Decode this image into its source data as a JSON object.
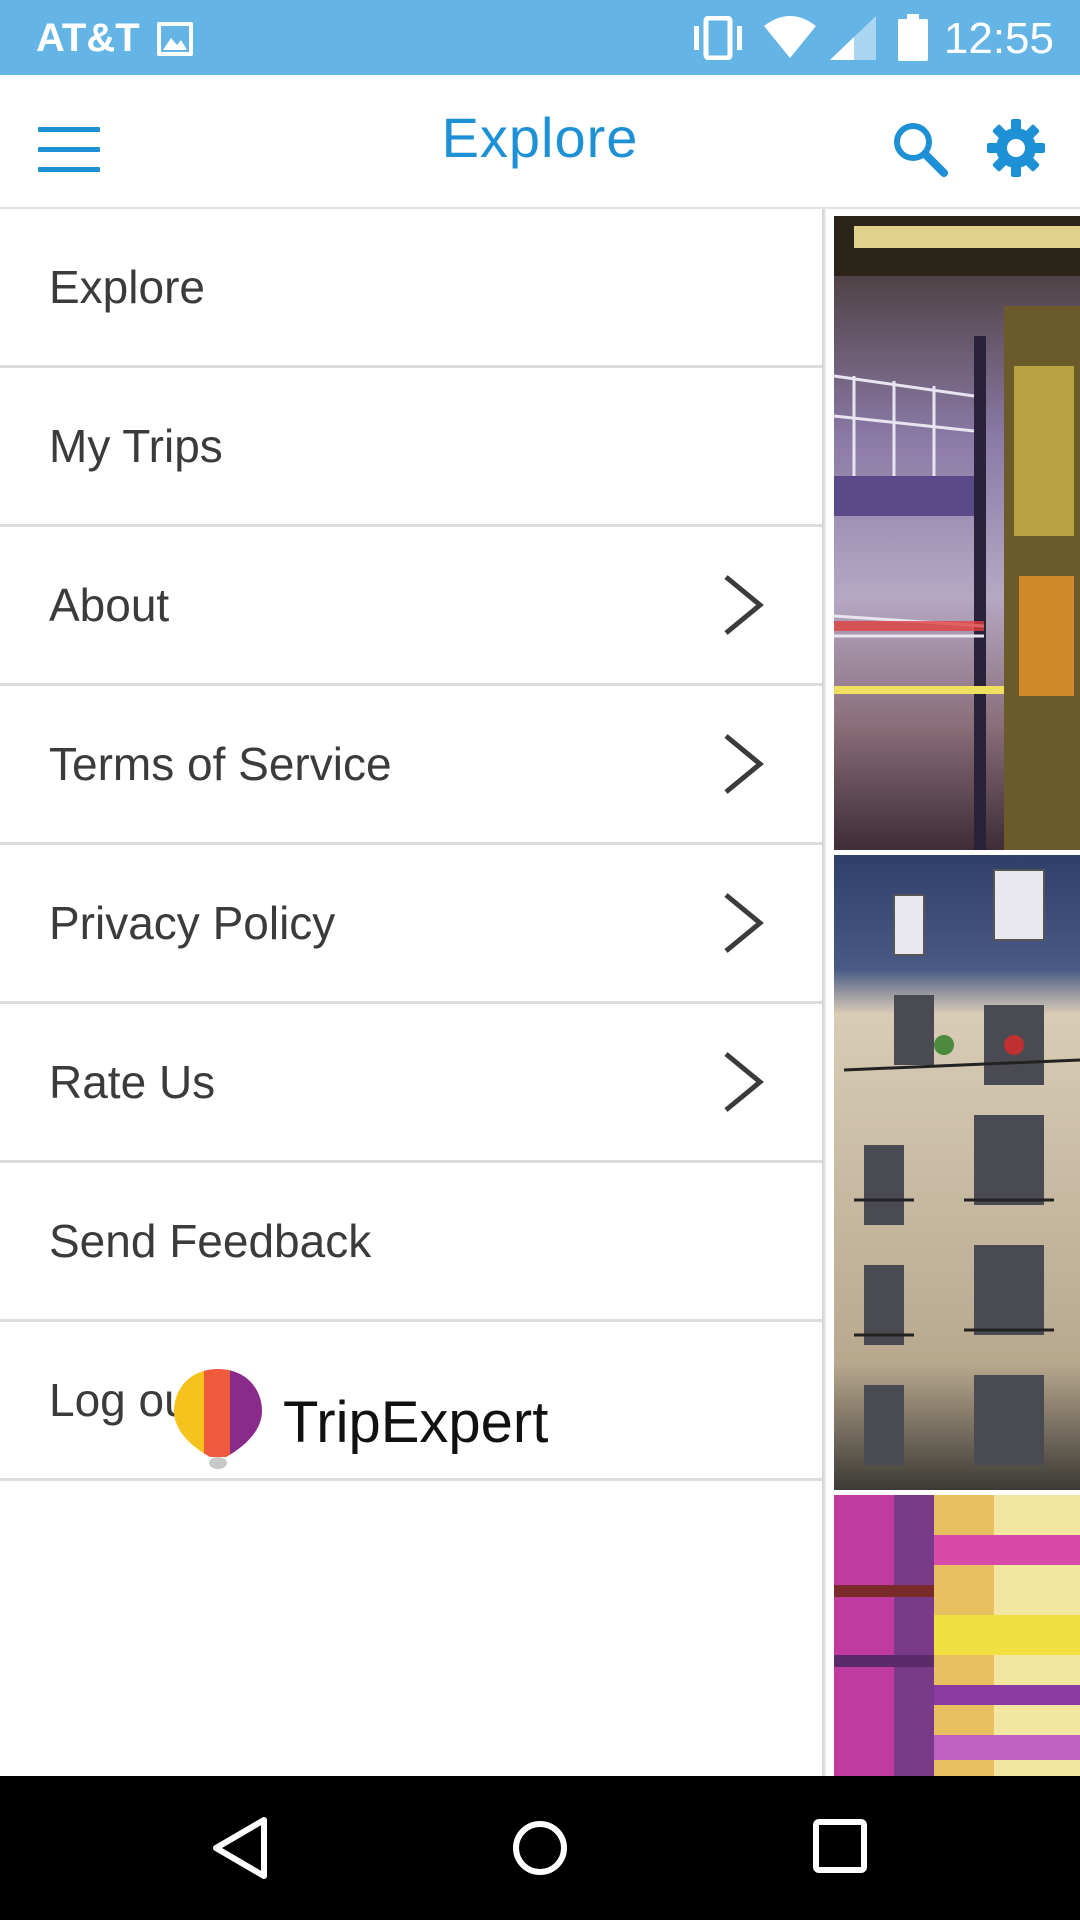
{
  "status_bar": {
    "carrier": "AT&T",
    "time": "12:55",
    "icons": [
      "image-icon",
      "vibrate-icon",
      "wifi-icon",
      "signal-icon",
      "battery-icon"
    ]
  },
  "app_bar": {
    "title": "Explore",
    "menu_icon": "hamburger-menu-icon",
    "search_icon": "search-icon",
    "settings_icon": "gear-icon",
    "accent_color": "#1e90d6"
  },
  "drawer": {
    "items": [
      {
        "label": "Explore",
        "has_chevron": false
      },
      {
        "label": "My Trips",
        "has_chevron": false
      },
      {
        "label": "About",
        "has_chevron": true
      },
      {
        "label": "Terms of Service",
        "has_chevron": true
      },
      {
        "label": "Privacy Policy",
        "has_chevron": true
      },
      {
        "label": "Rate Us",
        "has_chevron": true
      },
      {
        "label": "Send Feedback",
        "has_chevron": false
      },
      {
        "label": "Log out",
        "has_chevron": false
      }
    ],
    "brand": "TripExpert"
  },
  "photos": [
    "subway-platform-photo",
    "paris-building-photo",
    "colorful-glass-photo"
  ],
  "nav_bar": {
    "icons": [
      "back-icon",
      "home-icon",
      "recents-icon"
    ]
  }
}
